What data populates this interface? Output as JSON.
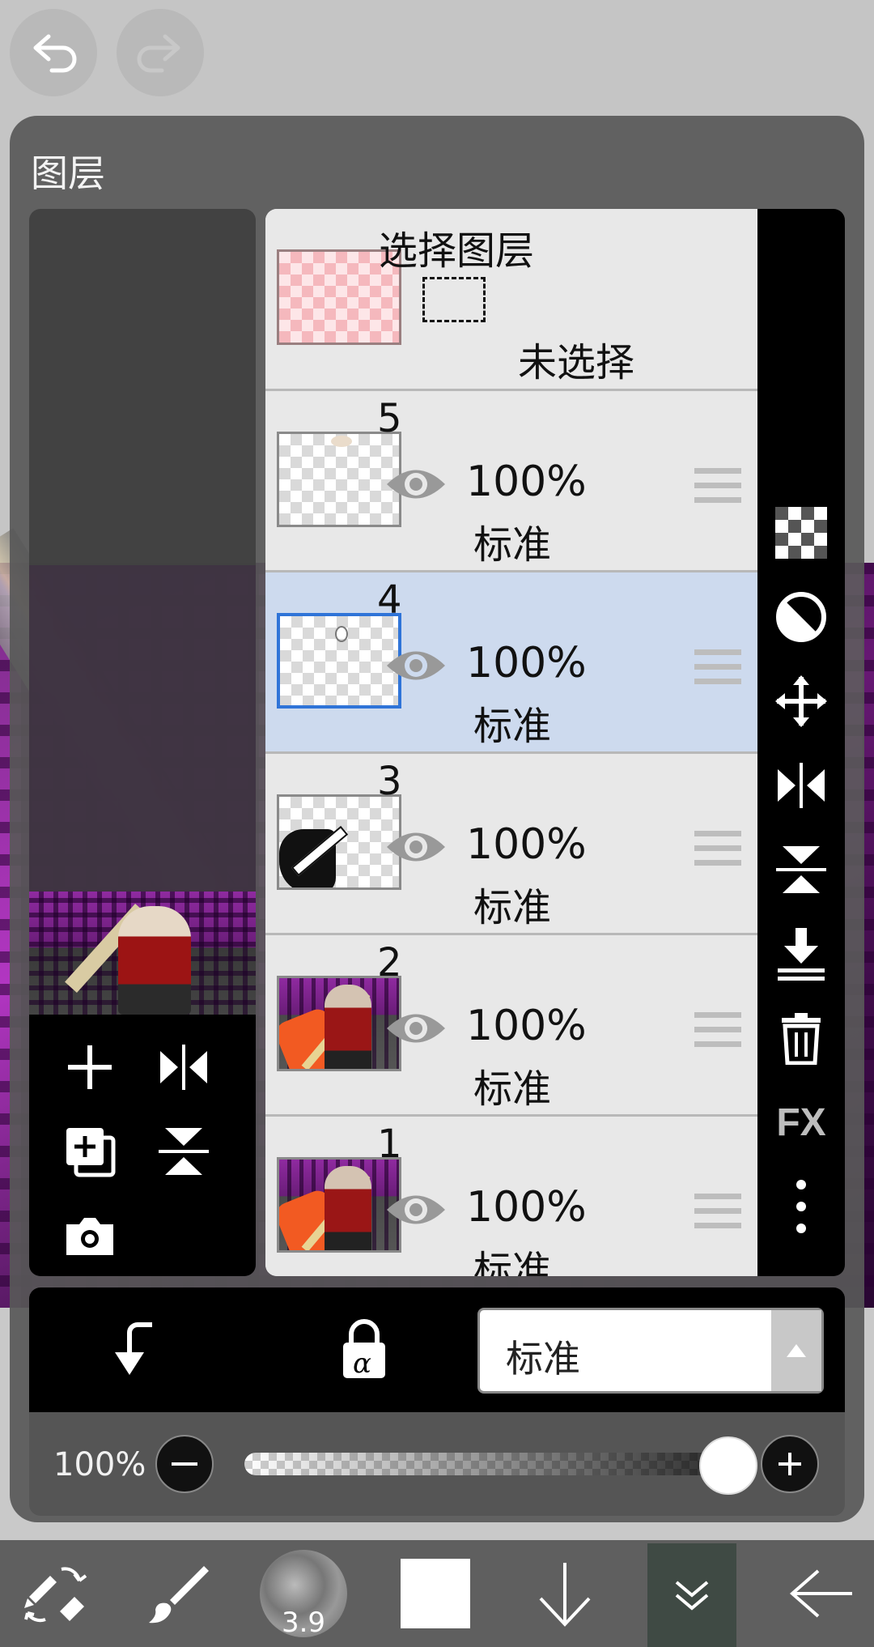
{
  "panel": {
    "title": "图层"
  },
  "selection_layer": {
    "title": "选择图层",
    "status": "未选择"
  },
  "layers": [
    {
      "number": "5",
      "opacity": "100%",
      "blend": "标准"
    },
    {
      "number": "4",
      "opacity": "100%",
      "blend": "标准",
      "selected": true
    },
    {
      "number": "3",
      "opacity": "100%",
      "blend": "标准"
    },
    {
      "number": "2",
      "opacity": "100%",
      "blend": "标准"
    },
    {
      "number": "1",
      "opacity": "100%",
      "blend": "标准"
    }
  ],
  "right_toolbar": {
    "fx_label": "FX",
    "icons": [
      "checker-icon",
      "half-circle-icon",
      "move-icon",
      "flip-horizontal-icon",
      "flip-vertical-icon",
      "merge-down-icon",
      "trash-icon",
      "fx-icon",
      "more-vertical-icon"
    ]
  },
  "left_tools": {
    "icons": [
      "plus-icon",
      "flip-horizontal-icon",
      "duplicate-icon",
      "flip-vertical-icon",
      "camera-icon"
    ]
  },
  "controls": {
    "blend_mode_value": "标准",
    "opacity_value": "100%",
    "opacity_level": 1.0,
    "lock_alpha_label": "α"
  },
  "bottom_toolbar": {
    "brush_size": "3.9",
    "icons": [
      "tool-swap-icon",
      "brush-icon",
      "brush-preview",
      "color-swatch",
      "arrow-down-icon",
      "chevron-double-down-icon",
      "back-arrow-icon"
    ]
  },
  "colors": {
    "selected_row": "#cddaee",
    "active_thumb_border": "#2f74d8",
    "panel_bg": "#585858"
  }
}
